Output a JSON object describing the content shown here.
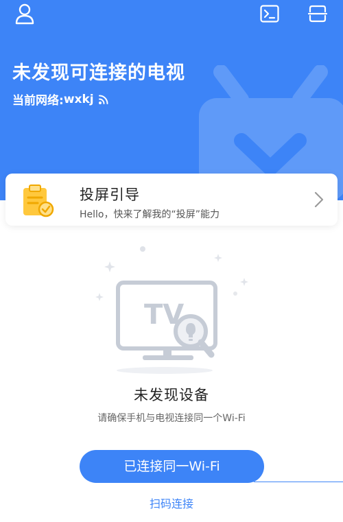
{
  "header": {
    "title": "未发现可连接的电视",
    "network_label": "当前网络:",
    "network_name": "wxkj"
  },
  "guide": {
    "title": "投屏引导",
    "subtitle": "Hello，快来了解我的“投屏”能力"
  },
  "illustration": {
    "tv_text": "TV"
  },
  "empty_state": {
    "title": "未发现设备",
    "description": "请确保手机与电视连接同一个Wi-Fi"
  },
  "actions": {
    "primary_label": "已连接同一Wi-Fi",
    "secondary_label": "扫码连接"
  },
  "colors": {
    "accent": "#3d84f7",
    "guide_icon": "#ffc83d"
  },
  "icons": {
    "top_left": "user-icon",
    "top_right_1": "terminal-icon",
    "top_right_2": "scan-icon",
    "network": "wifi-icon",
    "guide": "clipboard-check-icon",
    "guide_arrow": "chevron-right-icon"
  }
}
